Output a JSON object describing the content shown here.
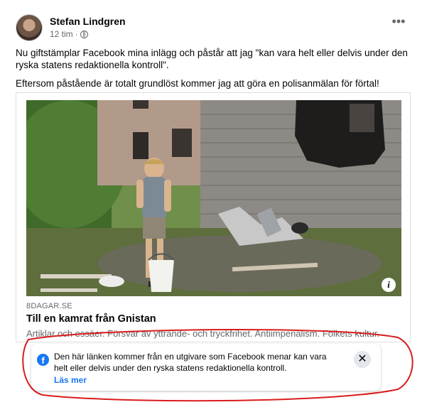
{
  "post": {
    "author": "Stefan Lindgren",
    "time": "12 tim",
    "separator": "·",
    "paragraph1": "Nu giftstämplar Facebook mina inlägg och påstår att jag \"kan vara helt eller delvis under den ryska statens redaktionella kontroll\".",
    "paragraph2": "Eftersom påstående är totalt grundlöst kommer jag att göra en polisanmälan för förtal!"
  },
  "link": {
    "domain": "8DAGAR.SE",
    "title": "Till en kamrat från Gnistan",
    "description": "Artiklar och essäer. Försvar av yttrande- och tryckfrihet. Antiimperialism. Folkets kultur.",
    "info_glyph": "i"
  },
  "notice": {
    "text": "Den här länken kommer från en utgivare som Facebook menar kan vara helt eller delvis under den ryska statens redaktionella kontroll.",
    "read_more": "Läs mer",
    "fb_glyph": "f",
    "close_glyph": "✕"
  },
  "icons": {
    "more": "•••"
  },
  "colors": {
    "facebook_blue": "#1877f2",
    "secondary_text": "#65676b",
    "annotation_red": "#d91c1c"
  }
}
